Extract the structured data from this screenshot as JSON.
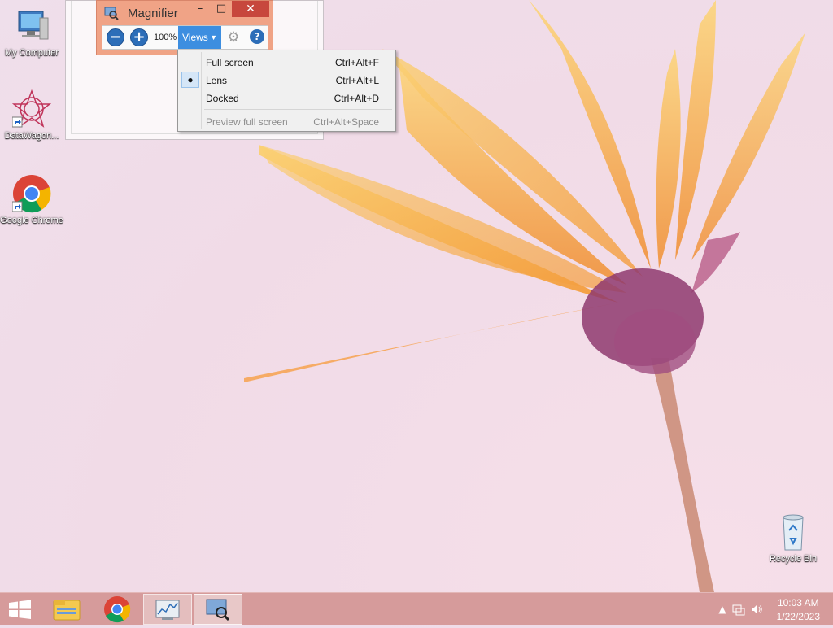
{
  "desktop": {
    "icons": [
      {
        "label": "My Computer",
        "icon": "computer-icon"
      },
      {
        "label": "DataWagon...",
        "icon": "datawagon-icon"
      },
      {
        "label": "Google Chrome",
        "icon": "chrome-icon"
      },
      {
        "label": "Recycle Bin",
        "icon": "recycle-bin-icon"
      }
    ]
  },
  "magnifier": {
    "title": "Magnifier",
    "minimize_glyph": "–",
    "maximize_glyph": "□",
    "close_glyph": "✕",
    "zoom_out_glyph": "−",
    "zoom_in_glyph": "+",
    "zoom_level": "100%",
    "views_label": "Views",
    "settings_glyph": "⚙",
    "help_glyph": "?"
  },
  "views_menu": {
    "items": [
      {
        "label": "Full screen",
        "shortcut": "Ctrl+Alt+F",
        "checked": false,
        "enabled": true
      },
      {
        "label": "Lens",
        "shortcut": "Ctrl+Alt+L",
        "checked": true,
        "enabled": true
      },
      {
        "label": "Docked",
        "shortcut": "Ctrl+Alt+D",
        "checked": false,
        "enabled": true
      },
      {
        "label": "Preview full screen",
        "shortcut": "Ctrl+Alt+Space",
        "checked": false,
        "enabled": false
      }
    ],
    "check_glyph": "●"
  },
  "taskbar": {
    "items": [
      "windows-start-icon",
      "file-explorer-icon",
      "chrome-icon",
      "performance-monitor-icon",
      "magnifier-icon"
    ],
    "clock_time": "10:03 AM",
    "clock_date": "1/22/2023"
  },
  "colors": {
    "taskbar": "#d69b9b",
    "magnifier_frame": "#f0a386",
    "accent_blue": "#3d8ee0",
    "close_red": "#c7473d"
  }
}
